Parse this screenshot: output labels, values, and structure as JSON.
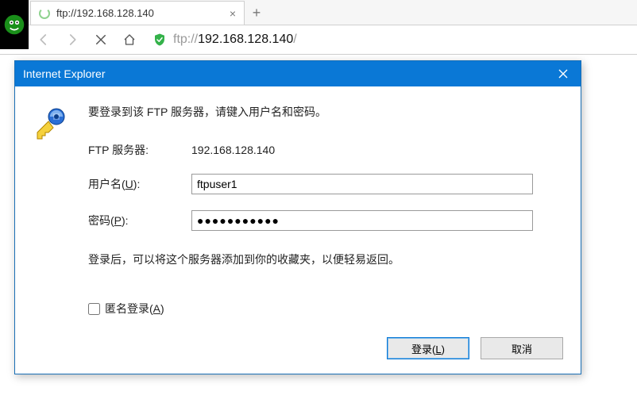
{
  "browser": {
    "tab_title": "ftp://192.168.128.140",
    "new_tab_glyph": "+",
    "close_tab_glyph": "×",
    "address": {
      "protocol": "ftp://",
      "host": "192.168.128.140",
      "trailing": "/"
    }
  },
  "dialog": {
    "title": "Internet Explorer",
    "instruction": "要登录到该 FTP 服务器，请键入用户名和密码。",
    "labels": {
      "server": "FTP 服务器:",
      "username_pre": "用户名(",
      "username_key": "U",
      "username_post": "):",
      "password_pre": "密码(",
      "password_key": "P",
      "password_post": "):",
      "anon_pre": "匿名登录(",
      "anon_key": "A",
      "anon_post": ")"
    },
    "values": {
      "server": "192.168.128.140",
      "username": "ftpuser1",
      "password": "●●●●●●●●●●●"
    },
    "note": "登录后，可以将这个服务器添加到你的收藏夹，以便轻易返回。",
    "buttons": {
      "login_pre": "登录(",
      "login_key": "L",
      "login_post": ")",
      "cancel": "取消"
    }
  }
}
